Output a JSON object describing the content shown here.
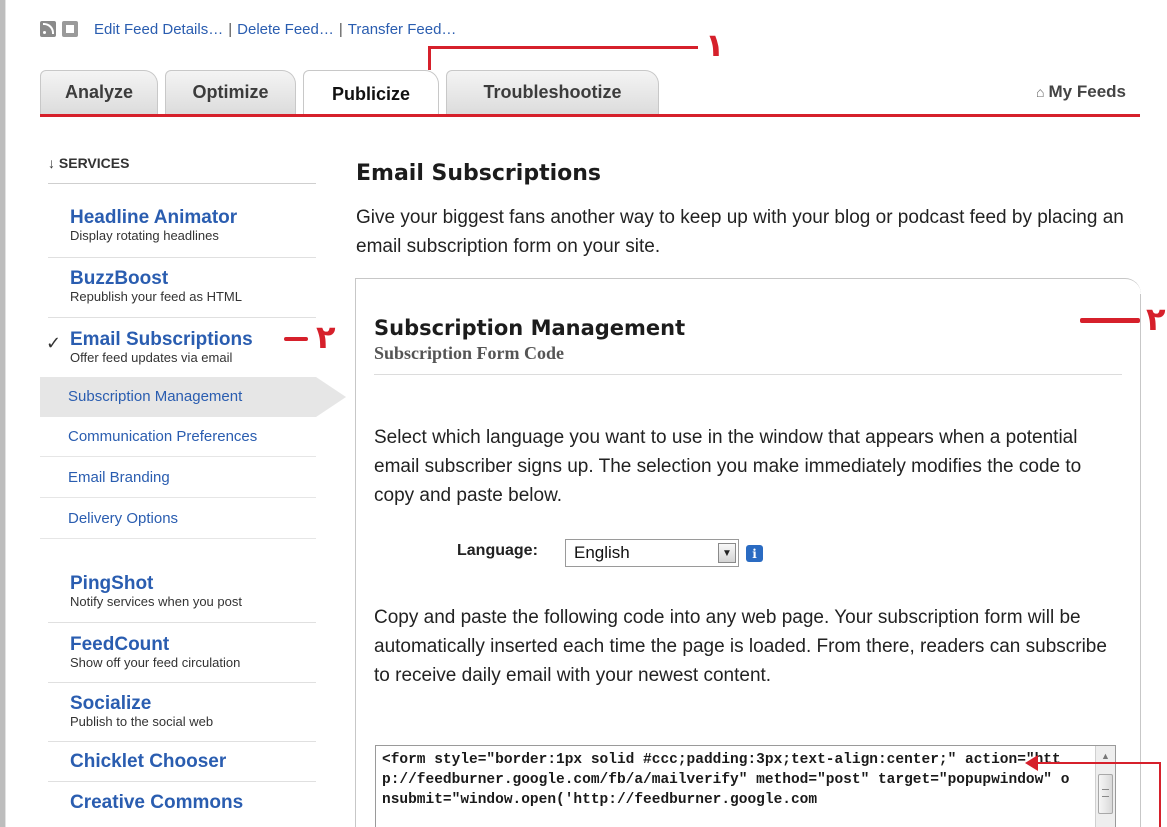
{
  "top_links": {
    "edit": "Edit Feed Details…",
    "delete": "Delete Feed…",
    "transfer": "Transfer Feed…",
    "separator": "|"
  },
  "tabs": {
    "analyze": "Analyze",
    "optimize": "Optimize",
    "publicize": "Publicize",
    "troubleshootize": "Troubleshootize",
    "active": "Publicize"
  },
  "my_feeds": "My Feeds",
  "annotations": {
    "one": "١",
    "two_a": "٢",
    "two_b": "٢"
  },
  "sidebar": {
    "services_label": "↓ SERVICES",
    "items": [
      {
        "name": "Headline Animator",
        "desc": "Display rotating headlines"
      },
      {
        "name": "BuzzBoost",
        "desc": "Republish your feed as HTML"
      },
      {
        "name": "Email Subscriptions",
        "desc": "Offer feed updates via email"
      },
      {
        "name": "PingShot",
        "desc": "Notify services when you post"
      },
      {
        "name": "FeedCount",
        "desc": "Show off your feed circulation"
      },
      {
        "name": "Socialize",
        "desc": "Publish to the social web"
      },
      {
        "name": "Chicklet Chooser",
        "desc": ""
      },
      {
        "name": "Creative Commons",
        "desc": ""
      }
    ],
    "check_mark": "✓",
    "sub_items": [
      {
        "label": "Subscription Management",
        "active": true
      },
      {
        "label": "Communication Preferences",
        "active": false
      },
      {
        "label": "Email Branding",
        "active": false
      },
      {
        "label": "Delivery Options",
        "active": false
      }
    ]
  },
  "main": {
    "title": "Email Subscriptions",
    "intro": "Give your biggest fans another way to keep up with your blog or podcast feed by placing an email subscription form on your site.",
    "panel_title": "Subscription Management",
    "form_code_title": "Subscription Form Code",
    "select_text": "Select which language you want to use in the window that appears when a potential email subscriber signs up. The selection you make immediately modifies the code to copy and paste below.",
    "language_label": "Language:",
    "language_value": "English",
    "info_glyph": "i",
    "copy_text": "Copy and paste the following code into any web page. Your subscription form will be automatically inserted each time the page is loaded. From there, readers can subscribe to receive daily email with your newest content.",
    "code": "<form style=\"border:1px solid #ccc;padding:3px;text-align:center;\" action=\"http://feedburner.google.com/fb/a/mailverify\" method=\"post\" target=\"popupwindow\" onsubmit=\"window.open('http://feedburner.google.com"
  },
  "colors": {
    "link": "#2a5db0",
    "annotation_red": "#d6202b",
    "tab_bg": "#dcdcdc"
  }
}
